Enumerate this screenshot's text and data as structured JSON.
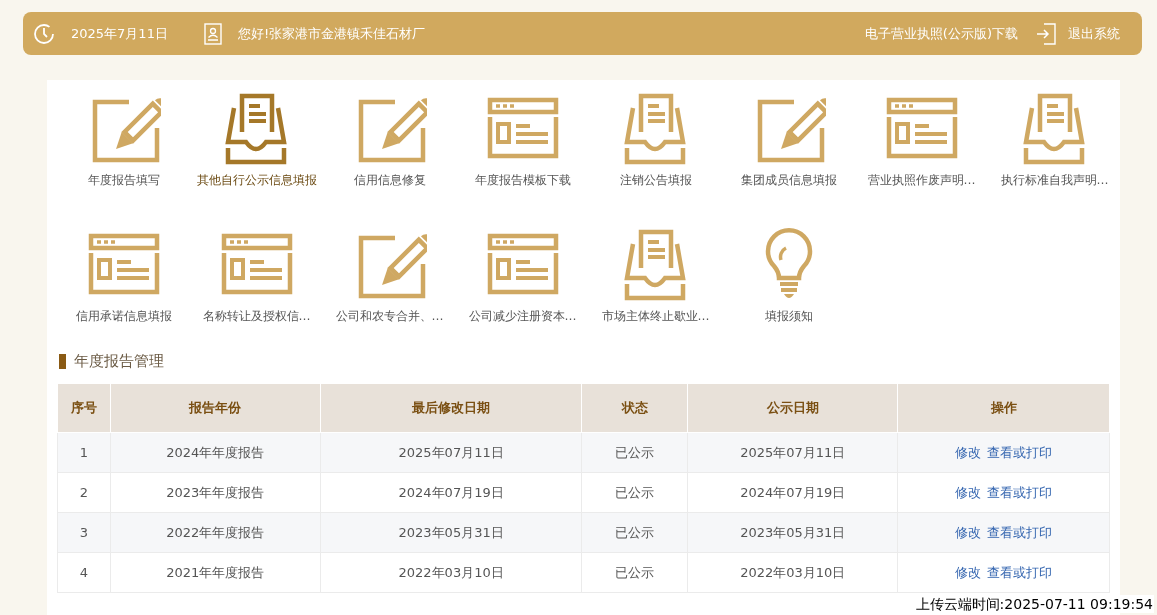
{
  "header": {
    "date": "2025年7月11日",
    "greeting": "您好!张家港市金港镇禾佳石材厂",
    "license_link": "电子营业执照(公示版)下载",
    "logout": "退出系统"
  },
  "shortcuts": [
    {
      "label": "年度报告填写",
      "kind": "pencil",
      "selected": false
    },
    {
      "label": "其他自行公示信息填报",
      "kind": "tray",
      "selected": true
    },
    {
      "label": "信用信息修复",
      "kind": "pencil",
      "selected": false
    },
    {
      "label": "年度报告模板下载",
      "kind": "browser",
      "selected": false
    },
    {
      "label": "注销公告填报",
      "kind": "tray",
      "selected": false
    },
    {
      "label": "集团成员信息填报",
      "kind": "pencil",
      "selected": false
    },
    {
      "label": "营业执照作废声明…",
      "kind": "browser",
      "selected": false
    },
    {
      "label": "执行标准自我声明…",
      "kind": "tray",
      "selected": false
    },
    {
      "label": "信用承诺信息填报",
      "kind": "browser",
      "selected": false
    },
    {
      "label": "名称转让及授权信…",
      "kind": "browser",
      "selected": false
    },
    {
      "label": "公司和农专合并、…",
      "kind": "pencil",
      "selected": false
    },
    {
      "label": "公司减少注册资本…",
      "kind": "browser",
      "selected": false
    },
    {
      "label": "市场主体终止歇业…",
      "kind": "tray",
      "selected": false
    },
    {
      "label": "填报须知",
      "kind": "bulb",
      "selected": false
    }
  ],
  "section_title": "年度报告管理",
  "table": {
    "columns": [
      "序号",
      "报告年份",
      "最后修改日期",
      "状态",
      "公示日期",
      "操作"
    ],
    "rows": [
      {
        "cells": [
          "1",
          "2024年年度报告",
          "2025年07月11日",
          "已公示",
          "2025年07月11日"
        ],
        "actions": [
          "修改",
          "查看或打印"
        ]
      },
      {
        "cells": [
          "2",
          "2023年年度报告",
          "2024年07月19日",
          "已公示",
          "2024年07月19日"
        ],
        "actions": [
          "修改",
          "查看或打印"
        ]
      },
      {
        "cells": [
          "3",
          "2022年年度报告",
          "2023年05月31日",
          "已公示",
          "2023年05月31日"
        ],
        "actions": [
          "修改",
          "查看或打印"
        ]
      },
      {
        "cells": [
          "4",
          "2021年年度报告",
          "2022年03月10日",
          "已公示",
          "2022年03月10日"
        ],
        "actions": [
          "修改",
          "查看或打印"
        ]
      }
    ]
  },
  "upload_stamp": "上传云端时间:2025-07-11 09:19:54"
}
